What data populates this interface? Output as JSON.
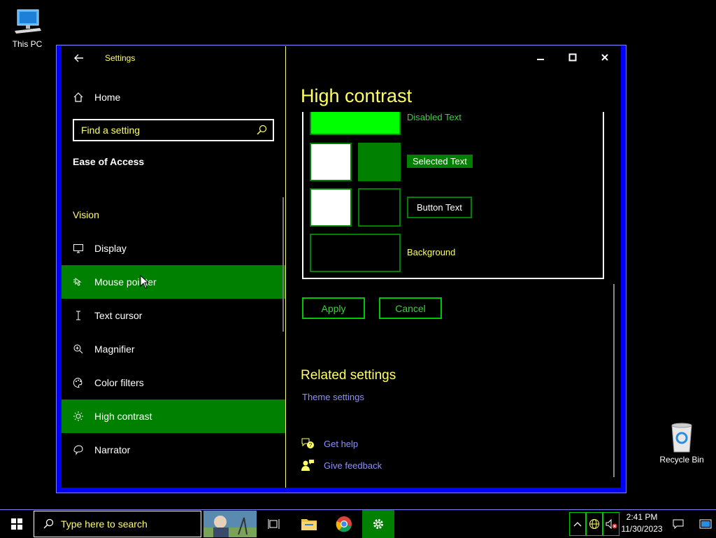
{
  "desktop": {
    "this_pc_label": "This PC",
    "recycle_bin_label": "Recycle Bin"
  },
  "window": {
    "app_title": "Settings",
    "nav": {
      "home": "Home",
      "search_placeholder": "Find a setting",
      "section": "Ease of Access",
      "group": "Vision",
      "items": [
        {
          "label": "Display",
          "icon": "display-icon"
        },
        {
          "label": "Mouse pointer",
          "icon": "mouse-pointer-icon",
          "active": true
        },
        {
          "label": "Text cursor",
          "icon": "text-cursor-icon"
        },
        {
          "label": "Magnifier",
          "icon": "magnifier-icon"
        },
        {
          "label": "Color filters",
          "icon": "color-filters-icon"
        },
        {
          "label": "High contrast",
          "icon": "high-contrast-icon",
          "active": true
        },
        {
          "label": "Narrator",
          "icon": "narrator-icon"
        }
      ]
    },
    "content": {
      "page_title": "High contrast",
      "preview": {
        "disabled_text": "Disabled Text",
        "selected_text": "Selected Text",
        "button_text": "Button Text",
        "background": "Background"
      },
      "apply_label": "Apply",
      "cancel_label": "Cancel",
      "related_title": "Related settings",
      "theme_settings_link": "Theme settings",
      "get_help": "Get help",
      "give_feedback": "Give feedback"
    }
  },
  "taskbar": {
    "search_placeholder": "Type here to search",
    "time": "2:41 PM",
    "date": "11/30/2023"
  },
  "colors": {
    "accent_green": "#008000",
    "text_yellow": "#ffff66",
    "link_blue": "#8f8fff",
    "window_border": "#0000ff"
  }
}
